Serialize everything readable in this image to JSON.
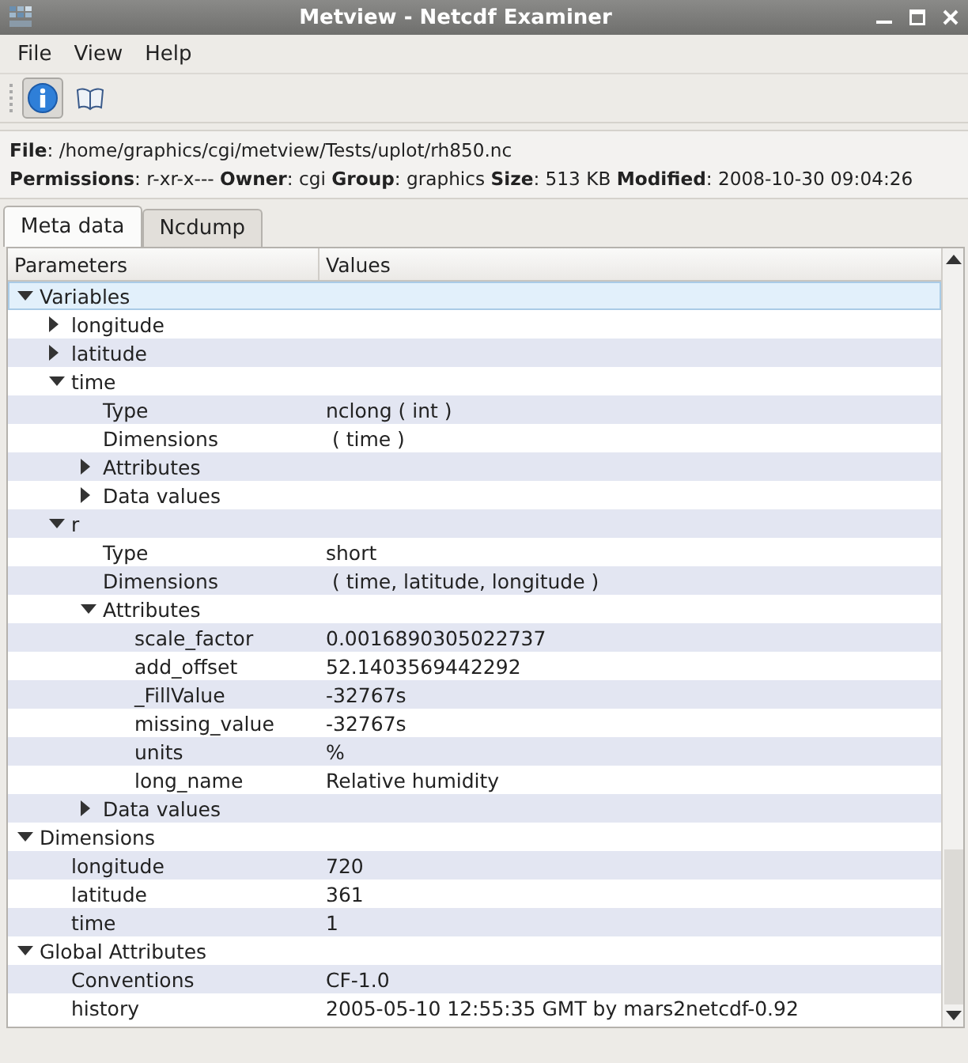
{
  "window": {
    "title": "Metview - Netcdf Examiner"
  },
  "menu": [
    "File",
    "View",
    "Help"
  ],
  "toolbar": [
    {
      "kind": "info",
      "selected": true
    },
    {
      "kind": "book",
      "selected": false
    }
  ],
  "info": [
    "**File**: /home/graphics/cgi/metview/Tests/uplot/rh850.nc",
    "**Permissions**: r-xr-x--- **Owner**: cgi **Group**: graphics **Size**: 513 KB **Modified**: 2008-10-30 09:04:26"
  ],
  "tabs": [
    {
      "label": "Meta data",
      "selected": true
    },
    {
      "label": "Ncdump",
      "selected": false
    }
  ],
  "columns": [
    "Parameters",
    "Values"
  ],
  "tree": [
    {
      "name": "Variables",
      "selected": true,
      "expanded": true,
      "children": [
        {
          "name": "longitude",
          "selected": false,
          "expanded": false
        },
        {
          "name": "latitude",
          "selected": false,
          "expanded": false
        },
        {
          "name": "time",
          "selected": false,
          "expanded": true,
          "children": [
            {
              "name": "Type",
              "value": "nclong ( int )",
              "selected": false
            },
            {
              "name": "Dimensions",
              "value": " ( time )",
              "selected": false
            },
            {
              "name": "Attributes",
              "selected": false,
              "expanded": false
            },
            {
              "name": "Data values",
              "selected": false,
              "expanded": false
            }
          ]
        },
        {
          "name": "r",
          "selected": false,
          "expanded": true,
          "children": [
            {
              "name": "Type",
              "value": "short",
              "selected": false
            },
            {
              "name": "Dimensions",
              "value": " ( time, latitude, longitude )",
              "selected": false
            },
            {
              "name": "Attributes",
              "selected": false,
              "expanded": true,
              "children": [
                {
                  "name": "scale_factor",
                  "value": "0.0016890305022737",
                  "selected": false
                },
                {
                  "name": "add_offset",
                  "value": "52.1403569442292",
                  "selected": false
                },
                {
                  "name": "_FillValue",
                  "value": "-32767s",
                  "selected": false
                },
                {
                  "name": "missing_value",
                  "value": "-32767s",
                  "selected": false
                },
                {
                  "name": "units",
                  "value": "%",
                  "selected": false
                },
                {
                  "name": "long_name",
                  "value": "Relative humidity",
                  "selected": false
                }
              ]
            },
            {
              "name": "Data values",
              "selected": false,
              "expanded": false
            }
          ]
        }
      ]
    },
    {
      "name": "Dimensions",
      "selected": false,
      "expanded": true,
      "children": [
        {
          "name": "longitude",
          "value": "720",
          "selected": false
        },
        {
          "name": "latitude",
          "value": "361",
          "selected": false
        },
        {
          "name": "time",
          "value": "1",
          "selected": false
        }
      ]
    },
    {
      "name": "Global Attributes",
      "selected": false,
      "expanded": true,
      "children": [
        {
          "name": "Conventions",
          "value": "CF-1.0",
          "selected": false
        },
        {
          "name": "history",
          "value": "2005-05-10 12:55:35 GMT by mars2netcdf-0.92",
          "selected": false
        }
      ]
    }
  ]
}
